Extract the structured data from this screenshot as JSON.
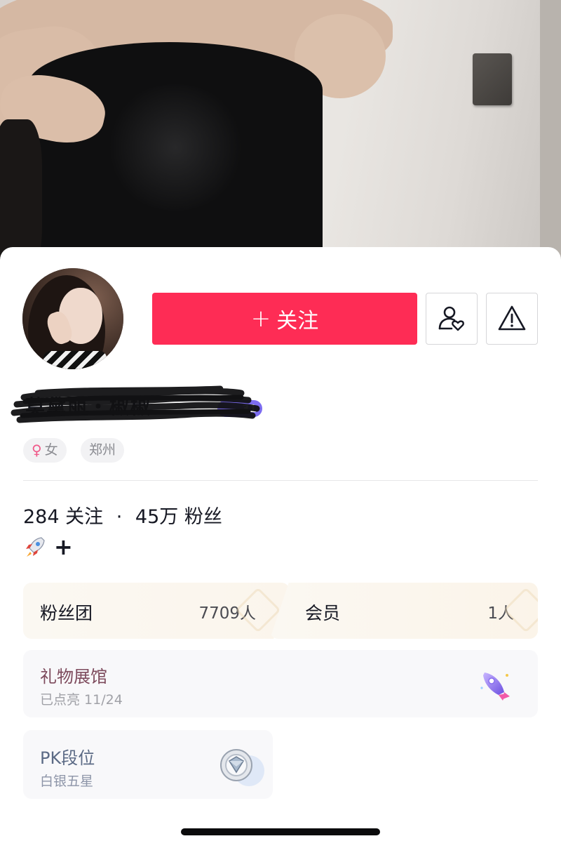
{
  "follow_button": {
    "label": "关注",
    "color": "#fe2c55"
  },
  "profile": {
    "username": "莫黛丽・椒椒",
    "level_badge": "31",
    "tags": {
      "gender": "女",
      "city": "郑州"
    }
  },
  "stats": {
    "following_count": "284",
    "following_label": "关注",
    "separator": "·",
    "followers_count": "45万",
    "followers_label": "粉丝"
  },
  "fan_club": {
    "label": "粉丝团",
    "value": "7709人"
  },
  "membership": {
    "label": "会员",
    "value": "1人"
  },
  "gift_gallery": {
    "title": "礼物展馆",
    "subtitle": "已点亮 11/24"
  },
  "pk_rank": {
    "title": "PK段位",
    "subtitle": "白银五星"
  },
  "icons": {
    "follow": "plus-icon",
    "friend": "person-heart-icon",
    "report": "warning-triangle-icon",
    "gender": "female-symbol-icon",
    "rocket": "rocket-emoji-icon",
    "add": "plus-icon"
  }
}
